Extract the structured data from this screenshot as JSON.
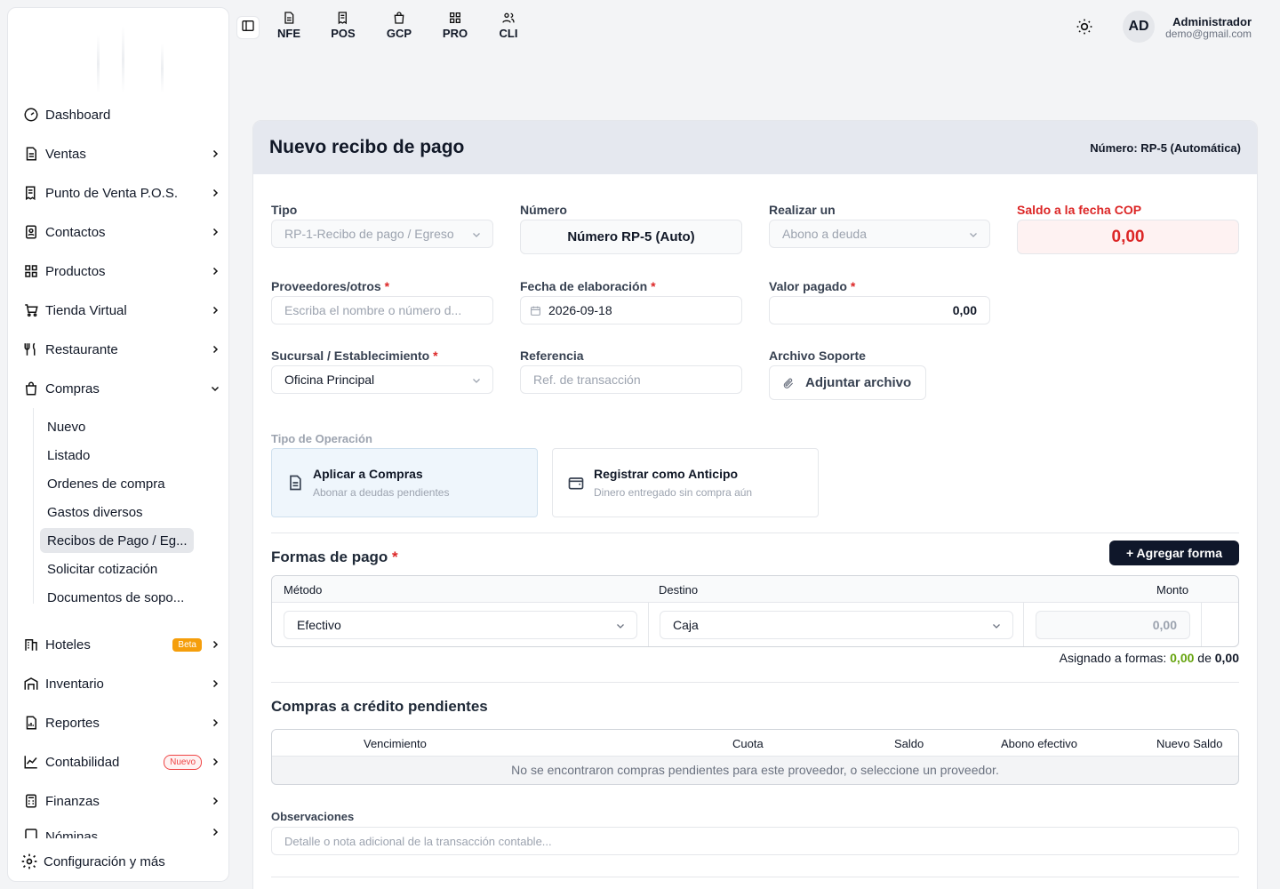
{
  "sidebar": {
    "items": [
      {
        "label": "Dashboard"
      },
      {
        "label": "Ventas"
      },
      {
        "label": "Punto de Venta P.O.S."
      },
      {
        "label": "Contactos"
      },
      {
        "label": "Productos"
      },
      {
        "label": "Tienda Virtual"
      },
      {
        "label": "Restaurante"
      },
      {
        "label": "Compras"
      },
      {
        "label": "Hoteles",
        "badge": "Beta"
      },
      {
        "label": "Inventario"
      },
      {
        "label": "Reportes"
      },
      {
        "label": "Contabilidad",
        "badge": "Nuevo"
      },
      {
        "label": "Finanzas"
      },
      {
        "label": "Nóminas"
      }
    ],
    "compras_sub": [
      {
        "label": "Nuevo"
      },
      {
        "label": "Listado"
      },
      {
        "label": "Ordenes de compra"
      },
      {
        "label": "Gastos diversos"
      },
      {
        "label": "Recibos de Pago / Eg..."
      },
      {
        "label": "Solicitar cotización"
      },
      {
        "label": "Documentos de sopo..."
      }
    ],
    "footer_label": "Configuración y más"
  },
  "topbar": {
    "shortcuts": [
      {
        "label": "NFE",
        "icon": "document-icon"
      },
      {
        "label": "POS",
        "icon": "receipt-icon"
      },
      {
        "label": "GCP",
        "icon": "shopping-bag-icon"
      },
      {
        "label": "PRO",
        "icon": "grid-icon"
      },
      {
        "label": "CLI",
        "icon": "users-icon"
      }
    ],
    "avatar_initials": "AD",
    "user_name": "Administrador",
    "user_email": "demo@gmail.com"
  },
  "card": {
    "title": "Nuevo recibo de pago",
    "number_text": "Número: RP-5 (Automática)"
  },
  "form": {
    "tipo_label": "Tipo",
    "tipo_value": "RP-1-Recibo de pago / Egreso",
    "numero_label": "Número",
    "numero_value": "Número RP-5 (Auto)",
    "realizar_label": "Realizar un",
    "realizar_value": "Abono a deuda",
    "saldo_label": "Saldo a la fecha COP",
    "saldo_value": "0,00",
    "proveedor_label": "Proveedores/otros",
    "proveedor_placeholder": "Escriba el nombre o número d...",
    "fecha_label": "Fecha de elaboración",
    "fecha_value": "2026-09-18",
    "valor_label": "Valor pagado",
    "valor_value": "0,00",
    "sucursal_label": "Sucursal / Establecimiento",
    "sucursal_value": "Oficina Principal",
    "referencia_label": "Referencia",
    "referencia_placeholder": "Ref. de transacción",
    "archivo_label": "Archivo Soporte",
    "archivo_button": "Adjuntar archivo",
    "required_mark": "*"
  },
  "operacion": {
    "label": "Tipo de Operación",
    "options": [
      {
        "title": "Aplicar a Compras",
        "desc": "Abonar a deudas pendientes",
        "selected": true
      },
      {
        "title": "Registrar como Anticipo",
        "desc": "Dinero entregado sin compra aún",
        "selected": false
      }
    ]
  },
  "pagos": {
    "title": "Formas de pago",
    "add_button": "+ Agregar forma",
    "headers": [
      "Método",
      "Destino",
      "Monto"
    ],
    "row": {
      "metodo": "Efectivo",
      "destino": "Caja",
      "monto": "0,00"
    },
    "asignado_label": "Asignado a formas:",
    "asignado_value": "0,00",
    "asignado_de": "de",
    "asignado_total": "0,00"
  },
  "compras_credito": {
    "title": "Compras a crédito pendientes",
    "headers": [
      "Vencimiento",
      "Cuota",
      "Saldo",
      "Abono efectivo",
      "Nuevo Saldo"
    ],
    "empty_text": "No se encontraron compras pendientes para este proveedor, o seleccione un proveedor."
  },
  "observaciones": {
    "label": "Observaciones",
    "placeholder": "Detalle o nota adicional de la transacción contable..."
  },
  "colors": {
    "accent_dark": "#0f172a",
    "danger": "#dc2626",
    "success": "#65a30d",
    "beta": "#f59e0b"
  }
}
